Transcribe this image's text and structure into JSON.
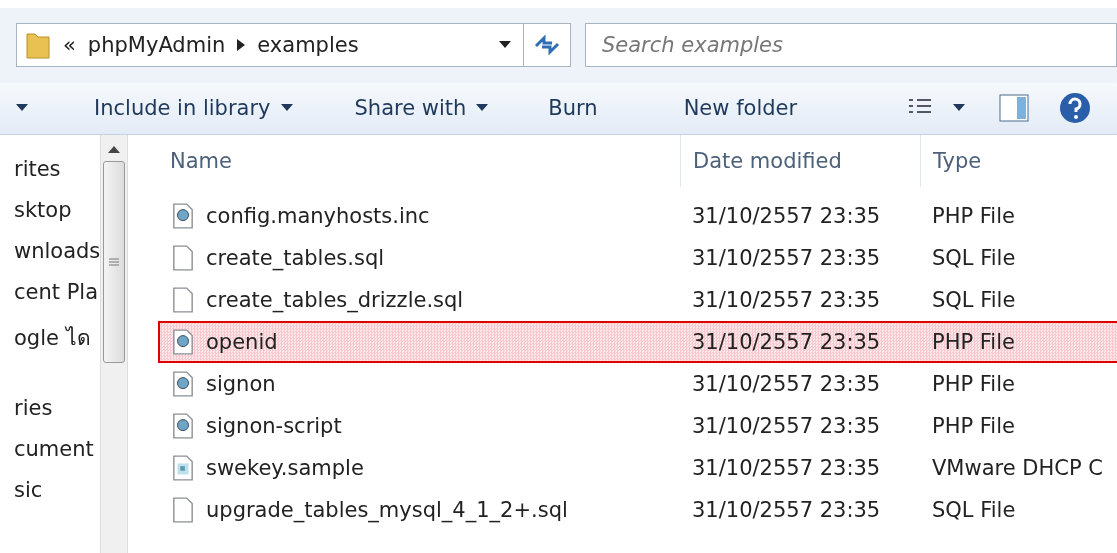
{
  "address_bar": {
    "overflow": "«",
    "path": [
      "phpMyAdmin",
      "examples"
    ]
  },
  "search": {
    "placeholder": "Search examples"
  },
  "toolbar": {
    "items": [
      "Include in library",
      "Share with",
      "Burn",
      "New folder"
    ]
  },
  "sidebar": {
    "groups": [
      {
        "items": [
          "rites",
          "sktop",
          "wnloads",
          "cent Pla",
          "ogle ได"
        ]
      },
      {
        "items": [
          "ries",
          "cument",
          "sic"
        ]
      }
    ]
  },
  "table": {
    "columns": [
      "Name",
      "Date modified",
      "Type"
    ],
    "rows": [
      {
        "name": "config.manyhosts.inc",
        "date": "31/10/2557 23:35",
        "type": "PHP File",
        "kind": "php",
        "highlighted": false
      },
      {
        "name": "create_tables.sql",
        "date": "31/10/2557 23:35",
        "type": "SQL File",
        "kind": "blank",
        "highlighted": false
      },
      {
        "name": "create_tables_drizzle.sql",
        "date": "31/10/2557 23:35",
        "type": "SQL File",
        "kind": "blank",
        "highlighted": false
      },
      {
        "name": "openid",
        "date": "31/10/2557 23:35",
        "type": "PHP File",
        "kind": "php",
        "highlighted": true
      },
      {
        "name": "signon",
        "date": "31/10/2557 23:35",
        "type": "PHP File",
        "kind": "php",
        "highlighted": false
      },
      {
        "name": "signon-script",
        "date": "31/10/2557 23:35",
        "type": "PHP File",
        "kind": "php",
        "highlighted": false
      },
      {
        "name": "swekey.sample",
        "date": "31/10/2557 23:35",
        "type": "VMware DHCP C",
        "kind": "config",
        "highlighted": false
      },
      {
        "name": "upgrade_tables_mysql_4_1_2+.sql",
        "date": "31/10/2557 23:35",
        "type": "SQL File",
        "kind": "blank",
        "highlighted": false
      }
    ]
  }
}
